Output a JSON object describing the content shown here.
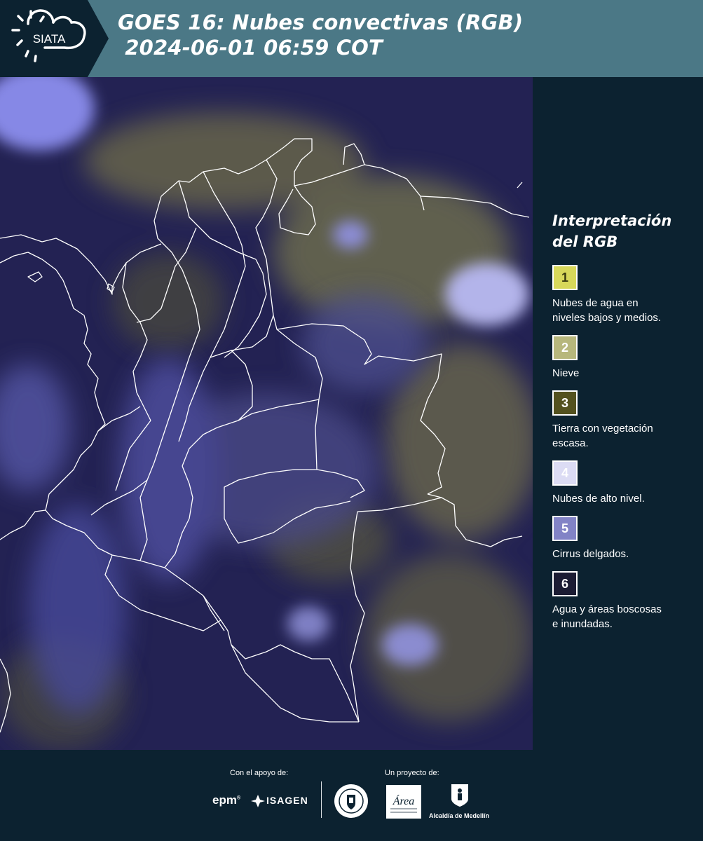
{
  "header": {
    "logo_text": "SIATA",
    "title_line1": "GOES 16: Nubes convectivas (RGB)",
    "title_line2": " 2024-06-01 06:59 COT"
  },
  "legend": {
    "title_line1": "Interpretación",
    "title_line2": "del RGB",
    "items": [
      {
        "number": "1",
        "color": "#d8d85a",
        "text_color": "#3a3a10",
        "line1": "Nubes de agua en",
        "line2": "niveles bajos y medios."
      },
      {
        "number": "2",
        "color": "#b7b77c",
        "text_color": "#ffffff",
        "line1": "Nieve",
        "line2": ""
      },
      {
        "number": "3",
        "color": "#53511e",
        "text_color": "#ffffff",
        "line1": "Tierra con vegetación",
        "line2": "escasa."
      },
      {
        "number": "4",
        "color": "#dcdcf4",
        "text_color": "#ffffff",
        "line1": "Nubes de alto nivel.",
        "line2": ""
      },
      {
        "number": "5",
        "color": "#8283c6",
        "text_color": "#ffffff",
        "line1": "Cirrus delgados.",
        "line2": ""
      },
      {
        "number": "6",
        "color": "#1b1c33",
        "text_color": "#ffffff",
        "line1": "Agua y áreas boscosas",
        "line2": "e inundadas."
      }
    ]
  },
  "footer": {
    "support_label": "Con el apoyo de:",
    "project_label": "Un proyecto de:",
    "sponsor1": "epm",
    "sponsor2": "ISAGEN",
    "partner_area": "Área",
    "partner_alcaldia": "Alcaldía de Medellín"
  },
  "colors": {
    "header_bg": "#4b7886",
    "page_bg": "#0c2230",
    "map_water": "#232253",
    "boundary": "#ffffff"
  }
}
